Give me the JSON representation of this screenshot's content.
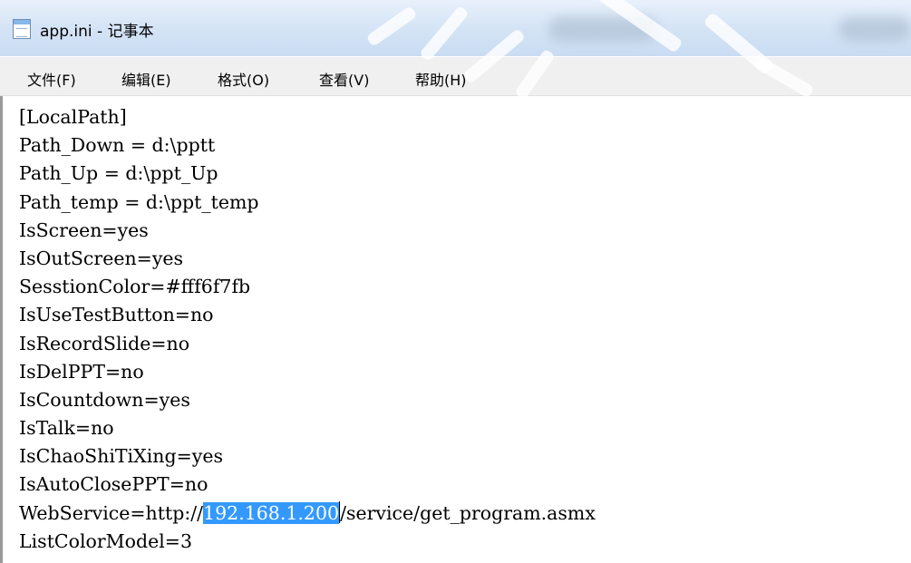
{
  "window": {
    "title": "app.ini - 记事本",
    "icon": "notepad-icon"
  },
  "menu": [
    {
      "label": "文件(F)"
    },
    {
      "label": "编辑(E)"
    },
    {
      "label": "格式(O)"
    },
    {
      "label": "查看(V)"
    },
    {
      "label": "帮助(H)"
    }
  ],
  "editor": {
    "lines": [
      "[LocalPath]",
      "Path_Down = d:\\pptt",
      "Path_Up = d:\\ppt_Up",
      "Path_temp = d:\\ppt_temp",
      "IsScreen=yes",
      "IsOutScreen=yes",
      "SesstionColor=#fff6f7fb",
      "IsUseTestButton=no",
      "IsRecordSlide=no",
      "IsDelPPT=no",
      "IsCountdown=yes",
      "IsTalk=no",
      "IsChaoShiTiXing=yes",
      "IsAutoClosePPT=no"
    ],
    "webservice_line": {
      "prefix": "WebService=http://",
      "selected": "192.168.1.200",
      "suffix": "/service/get_program.asmx"
    },
    "last_line": "ListColorModel=3"
  },
  "colors": {
    "selection": "#3399ff",
    "titlebar": "#d6e5f6",
    "menubar": "#f0f0f0"
  }
}
